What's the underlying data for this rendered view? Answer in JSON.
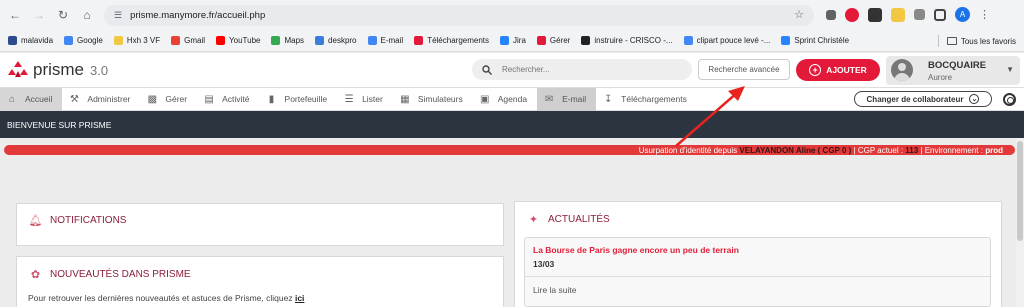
{
  "browser": {
    "url": "prisme.manymore.fr/accueil.php",
    "profile_initial": "A",
    "bookmarks": [
      {
        "label": "malavida",
        "color": "#2b4b8c"
      },
      {
        "label": "Google",
        "color": "#4285f4"
      },
      {
        "label": "Hxh 3 VF",
        "color": "#f2c744"
      },
      {
        "label": "Gmail",
        "color": "#ea4335"
      },
      {
        "label": "YouTube",
        "color": "#ff0000"
      },
      {
        "label": "Maps",
        "color": "#34a853"
      },
      {
        "label": "deskpro",
        "color": "#3b7ddd"
      },
      {
        "label": "E-mail",
        "color": "#4285f4"
      },
      {
        "label": "Téléchargements",
        "color": "#e3193a"
      },
      {
        "label": "Jira",
        "color": "#2684ff"
      },
      {
        "label": "Gérer",
        "color": "#e3193a"
      },
      {
        "label": "instruire - CRISCO -...",
        "color": "#222222"
      },
      {
        "label": "clipart pouce levé -...",
        "color": "#4285f4"
      },
      {
        "label": "Sprint Christèle",
        "color": "#2684ff"
      }
    ],
    "all_bookmarks_label": "Tous les favoris"
  },
  "header": {
    "logo_text": "prisme",
    "logo_version": "3.0",
    "search_placeholder": "Rechercher...",
    "advanced_search_label": "Recherche avancée",
    "add_label": "AJOUTER",
    "user_lastname": "BOCQUAIRE",
    "user_firstname": "Aurore"
  },
  "nav": {
    "items": [
      {
        "label": "Accueil",
        "icon": "home-icon"
      },
      {
        "label": "Administrer",
        "icon": "tools-icon"
      },
      {
        "label": "Gérer",
        "icon": "briefcase-icon"
      },
      {
        "label": "Activité",
        "icon": "activity-icon"
      },
      {
        "label": "Portefeuille",
        "icon": "chart-icon"
      },
      {
        "label": "Lister",
        "icon": "list-icon"
      },
      {
        "label": "Simulateurs",
        "icon": "calculator-icon"
      },
      {
        "label": "Agenda",
        "icon": "calendar-icon"
      },
      {
        "label": "E-mail",
        "icon": "email-icon"
      },
      {
        "label": "Téléchargements",
        "icon": "download-icon"
      }
    ],
    "collab_label": "Changer de collaborateur"
  },
  "welcome_text": "BIENVENUE SUR PRISME",
  "alert": {
    "prefix": "Usurpation d'identité depuis",
    "user": "VELAYANDON Aline ( CGP 0 )",
    "cgp_label": "| CGP actuel :",
    "cgp_value": "113",
    "env_label": "| Environnement :",
    "env_value": "prod"
  },
  "panels": {
    "notifications_title": "NOTIFICATIONS",
    "news_title": "NOUVEAUTÉS DANS PRISME",
    "news_text": "Pour retrouver les dernières nouveautés et astuces de Prisme, cliquez",
    "news_link": "ici",
    "actualites_title": "ACTUALITÉS",
    "actualite": {
      "headline": "La Bourse de Paris gagne encore un peu de terrain",
      "date": "13/03",
      "more": "Lire la suite"
    }
  },
  "colors": {
    "brand_red": "#e3193a",
    "dark_band": "#2c3440",
    "alert_red": "#e23a3a"
  }
}
